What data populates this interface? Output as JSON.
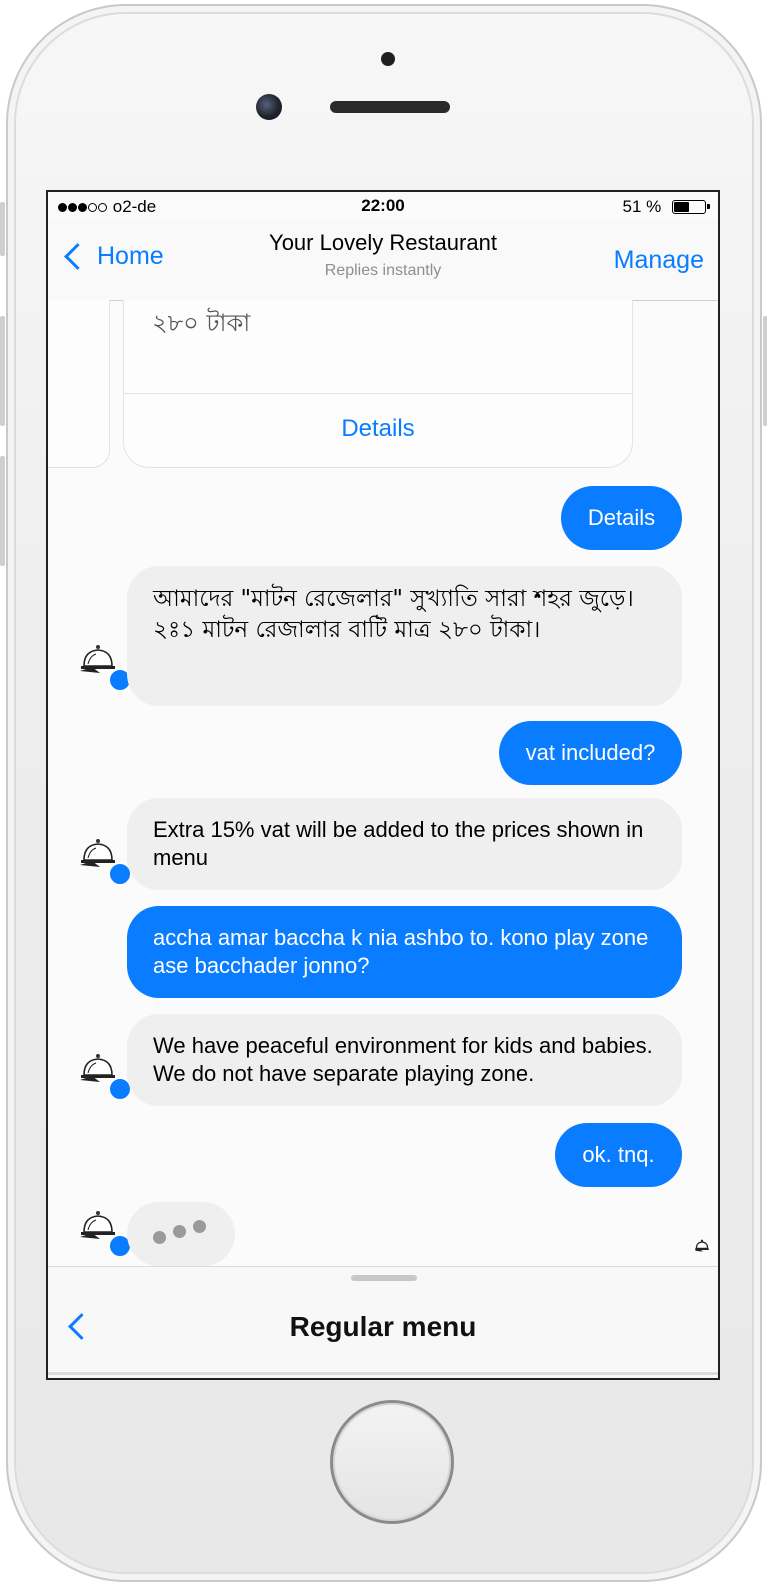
{
  "status_bar": {
    "carrier": "o2-de",
    "time": "22:00",
    "battery_percent": "51 %",
    "battery_level": 0.51,
    "signal_bars_filled": 3,
    "signal_bars_total": 5
  },
  "header": {
    "back_label": "Home",
    "title": "Your Lovely Restaurant",
    "subtitle": "Replies instantly",
    "manage_label": "Manage"
  },
  "card": {
    "price": "২৮০ টাকা",
    "button_label": "Details"
  },
  "messages": [
    {
      "from": "user",
      "text": "Details"
    },
    {
      "from": "bot",
      "text": "আমাদের \"মাটন রেজেলার\" সুখ্যাতি সারা শহর জুড়ে। ২ঃ১ মাটন রেজালার বাটি মাত্র ২৮০ টাকা।"
    },
    {
      "from": "user",
      "text": "vat included?"
    },
    {
      "from": "bot",
      "text": "Extra 15% vat will be added to the prices shown in menu"
    },
    {
      "from": "user",
      "text": "accha amar baccha k nia ashbo to. kono play zone ase bacchader jonno?"
    },
    {
      "from": "bot",
      "text": "We have peaceful environment for kids and babies. We do not have separate playing zone."
    },
    {
      "from": "user",
      "text": "ok. tnq."
    }
  ],
  "typing_indicator": "bot",
  "menu": {
    "title": "Regular menu"
  },
  "colors": {
    "accent": "#0a7cff",
    "incoming_bubble": "#efefef"
  },
  "icons": {
    "avatar": "restaurant-cloche-icon",
    "badge": "messenger-icon"
  }
}
